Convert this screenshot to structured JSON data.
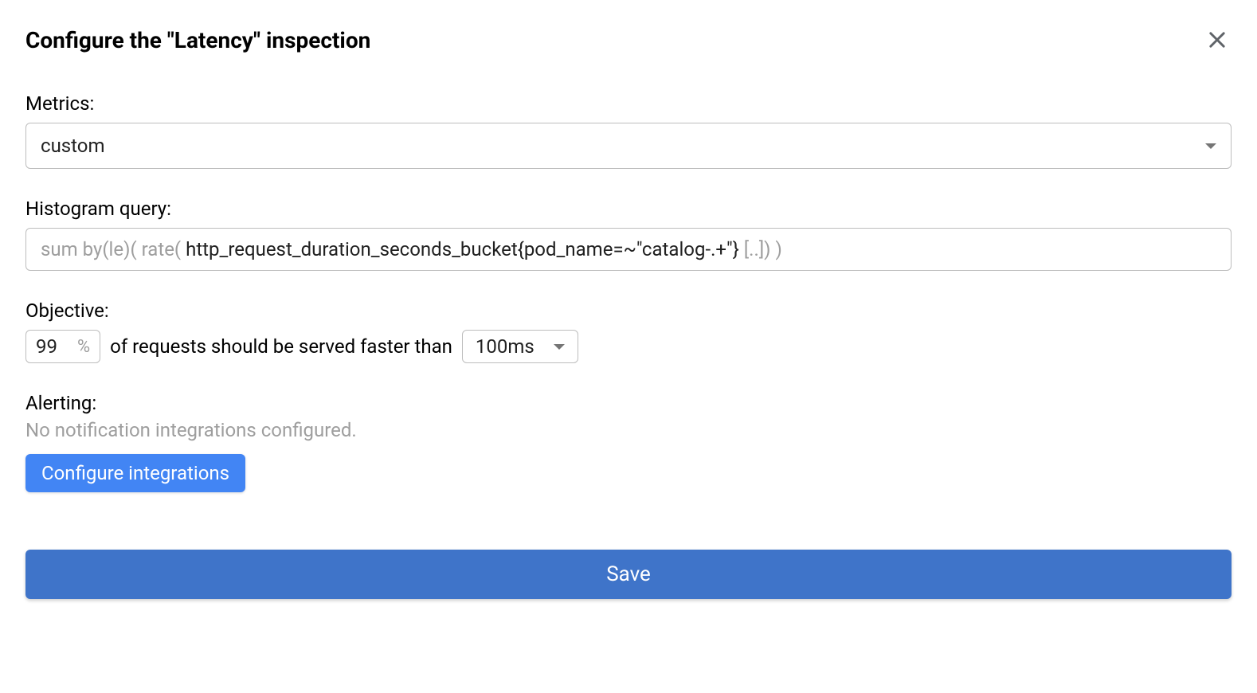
{
  "header": {
    "title": "Configure the \"Latency\" inspection"
  },
  "metrics": {
    "label": "Metrics:",
    "value": "custom"
  },
  "histogram": {
    "label": "Histogram query:",
    "prefix": "sum by(le)( rate( ",
    "main": "http_request_duration_seconds_bucket{pod_name=~\"catalog-.+\"}",
    "suffix": " [..]) )"
  },
  "objective": {
    "label": "Objective:",
    "percent_value": "99",
    "percent_sign": "%",
    "text": "of requests should be served faster than",
    "threshold": "100ms"
  },
  "alerting": {
    "label": "Alerting:",
    "status": "No notification integrations configured.",
    "configure_button": "Configure integrations"
  },
  "actions": {
    "save": "Save"
  }
}
